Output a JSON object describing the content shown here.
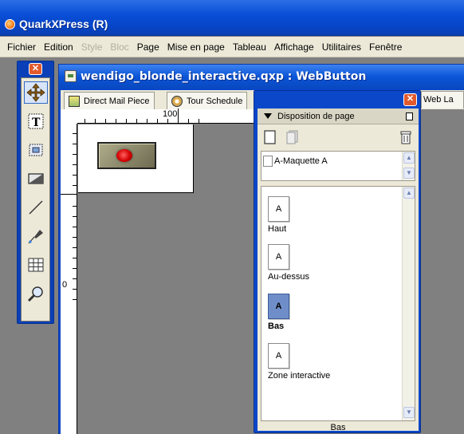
{
  "app": {
    "title": "QuarkXPress (R)"
  },
  "menu": [
    {
      "label": "Fichier",
      "enabled": true
    },
    {
      "label": "Edition",
      "enabled": true
    },
    {
      "label": "Style",
      "enabled": false
    },
    {
      "label": "Bloc",
      "enabled": false
    },
    {
      "label": "Page",
      "enabled": true
    },
    {
      "label": "Mise en page",
      "enabled": true
    },
    {
      "label": "Tableau",
      "enabled": true
    },
    {
      "label": "Affichage",
      "enabled": true
    },
    {
      "label": "Utilitaires",
      "enabled": true
    },
    {
      "label": "Fenêtre",
      "enabled": true
    }
  ],
  "tools": [
    {
      "name": "item-tool",
      "icon": "move-arrows-icon",
      "active": true
    },
    {
      "name": "text-content-tool",
      "icon": "text-icon"
    },
    {
      "name": "picture-content-tool",
      "icon": "picture-icon"
    },
    {
      "name": "rectangle-box-tool",
      "icon": "rectangle-icon"
    },
    {
      "name": "line-tool",
      "icon": "line-icon"
    },
    {
      "name": "bezier-pen-tool",
      "icon": "pen-icon"
    },
    {
      "name": "table-tool",
      "icon": "table-icon"
    },
    {
      "name": "zoom-tool",
      "icon": "magnifier-icon"
    }
  ],
  "document": {
    "title": "wendigo_blonde_interactive.qxp : WebButton",
    "tabs": [
      {
        "label": "Direct Mail Piece",
        "icon": "page-icon"
      },
      {
        "label": "Tour Schedule",
        "icon": "clock-icon"
      },
      {
        "label": "Web La",
        "icon": "page-icon"
      }
    ],
    "ruler": {
      "top_label": "100",
      "left_label": "0"
    }
  },
  "palette": {
    "title": "Disposition de page",
    "master_pages": [
      {
        "label": "A-Maquette A"
      }
    ],
    "pages": [
      {
        "label": "Haut",
        "icon_letter": "A",
        "selected": false
      },
      {
        "label": "Au-dessus",
        "icon_letter": "A",
        "selected": false
      },
      {
        "label": "Bas",
        "icon_letter": "A",
        "selected": true
      },
      {
        "label": "Zone interactive",
        "icon_letter": "A",
        "selected": false
      }
    ],
    "status": "Bas"
  },
  "colors": {
    "titlebar": "#0a4fd7",
    "chrome": "#ece9d8",
    "close": "#e35a2d",
    "selected_page": "#6f8ec9"
  }
}
